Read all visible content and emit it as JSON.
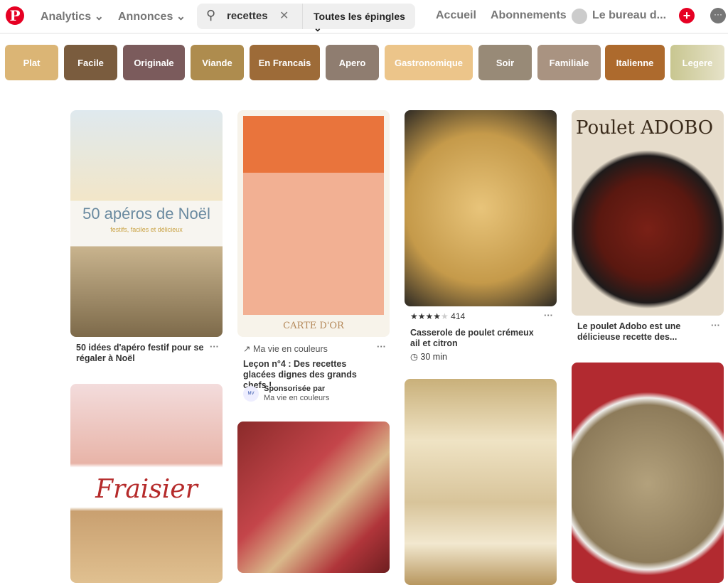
{
  "header": {
    "logo": "P",
    "analytics": "Analytics",
    "annonces": "Annonces",
    "search_value": "recettes",
    "search_scope": "Toutes les épingles",
    "accueil": "Accueil",
    "abonnements": "Abonnements",
    "account": "Le bureau d..."
  },
  "chips": [
    {
      "label": "Plat",
      "color": "#dbb575"
    },
    {
      "label": "Facile",
      "color": "#7a5c3e"
    },
    {
      "label": "Originale",
      "color": "#7b5b5c"
    },
    {
      "label": "Viande",
      "color": "#ae8c4e"
    },
    {
      "label": "En Francais",
      "color": "#9d6b38"
    },
    {
      "label": "Apero",
      "color": "#8f7d70"
    },
    {
      "label": "Gastronomique",
      "color": "#ecc58a"
    },
    {
      "label": "Soir",
      "color": "#988a77"
    },
    {
      "label": "Familiale",
      "color": "#a99381"
    },
    {
      "label": "Italienne",
      "color": "#ad6a2d"
    },
    {
      "label": "Legere",
      "color": "#c8c690"
    }
  ],
  "pins": {
    "p1": {
      "title": "50 idées d'apéro festif pour se régaler à Noël",
      "img_text": "50 apéros de Noël",
      "img_sub": "festifs, faciles et délicieux"
    },
    "p2": {
      "img_text": "Fraisier"
    },
    "p3": {
      "source": "Ma vie en couleurs",
      "title": "Leçon n°4 : Des recettes glacées dignes des grands chefs !",
      "sponsored": "Sponsorisée par",
      "sponsor": "Ma vie en couleurs",
      "img_text": "CARTE D'OR"
    },
    "p5": {
      "rating": 4,
      "reviews": "414",
      "title": "Casserole de poulet crémeux ail et citron",
      "time": "30 min"
    },
    "p7": {
      "title": "Le poulet Adobo est une délicieuse recette des...",
      "img_text": "Poulet ADOBO"
    },
    "more": "···"
  }
}
